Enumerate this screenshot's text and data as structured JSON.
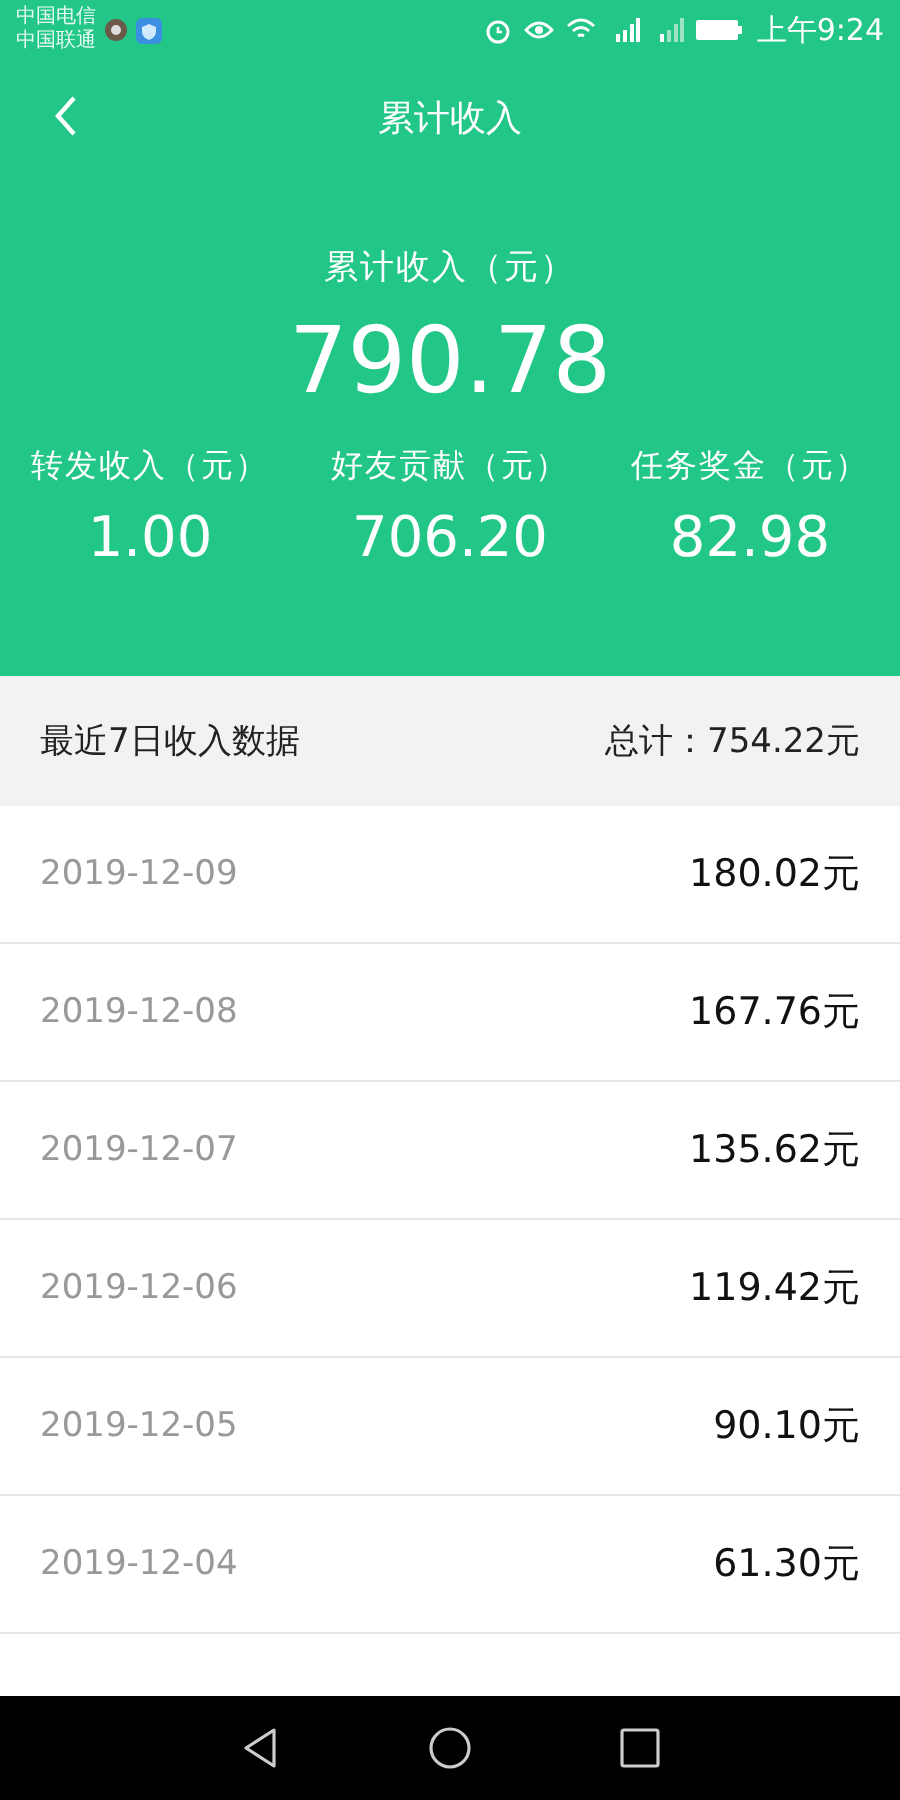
{
  "status_bar": {
    "carriers": [
      "中国电信",
      "中国联通"
    ],
    "time": "上午9:24"
  },
  "header": {
    "title": "累计收入"
  },
  "summary": {
    "label": "累计收入（元）",
    "total": "790.78",
    "stats": [
      {
        "label": "转发收入（元）",
        "value": "1.00"
      },
      {
        "label": "好友贡献（元）",
        "value": "706.20"
      },
      {
        "label": "任务奖金（元）",
        "value": "82.98"
      }
    ]
  },
  "recent": {
    "title": "最近7日收入数据",
    "total": "总计：754.22元",
    "rows": [
      {
        "date": "2019-12-09",
        "amount": "180.02元"
      },
      {
        "date": "2019-12-08",
        "amount": "167.76元"
      },
      {
        "date": "2019-12-07",
        "amount": "135.62元"
      },
      {
        "date": "2019-12-06",
        "amount": "119.42元"
      },
      {
        "date": "2019-12-05",
        "amount": "90.10元"
      },
      {
        "date": "2019-12-04",
        "amount": "61.30元"
      }
    ]
  }
}
